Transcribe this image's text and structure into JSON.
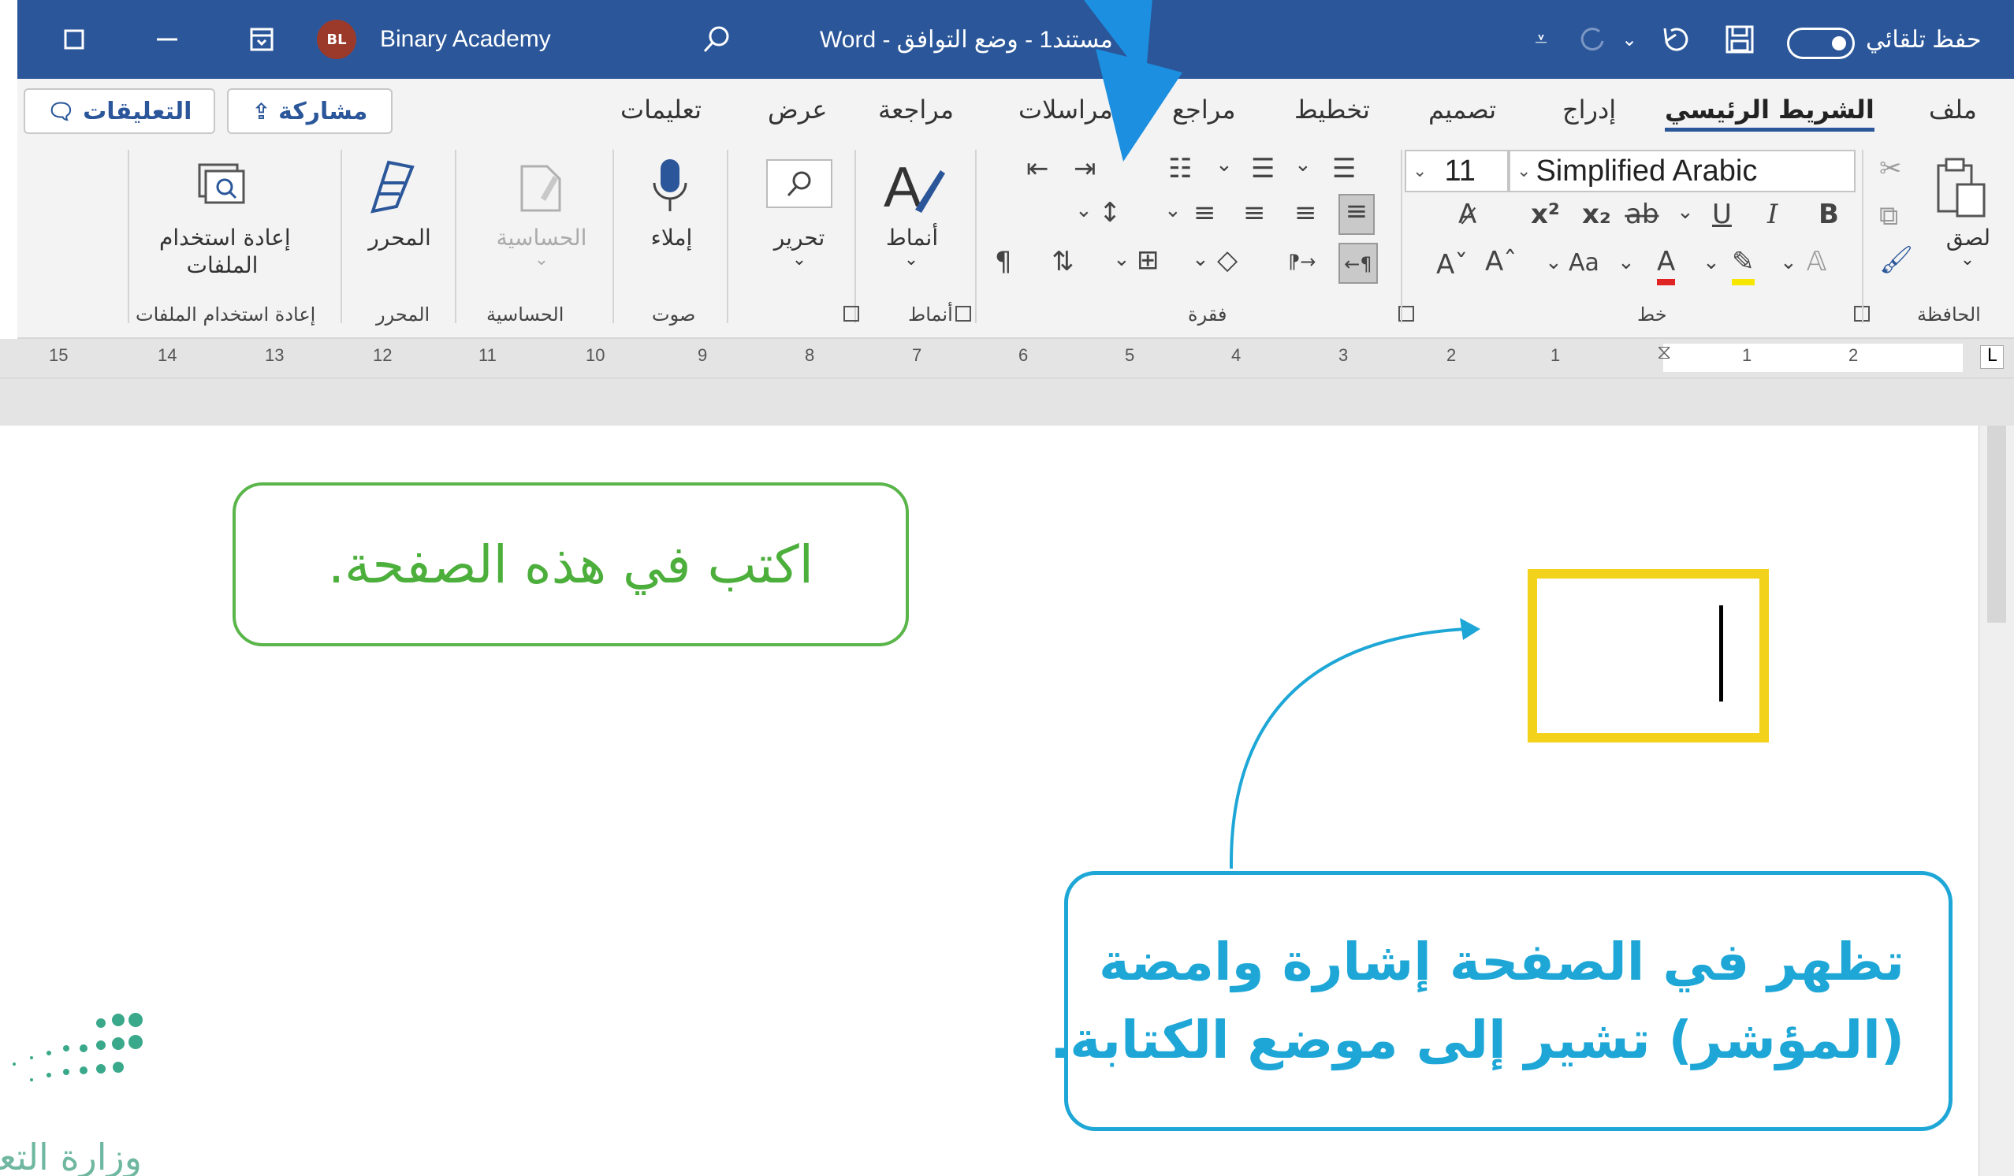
{
  "titlebar": {
    "account_name": "Binary Academy",
    "avatar_initials": "BL",
    "doc_title": "مستند1  -  وضع التوافق  -  Word",
    "autosave_label": "حفظ تلقائي"
  },
  "menu": {
    "tabs": [
      "ملف",
      "الشريط الرئيسي",
      "إدراج",
      "تصميم",
      "تخطيط",
      "مراجع",
      "مراسلات",
      "مراجعة",
      "عرض",
      "تعليمات"
    ],
    "active_tab": "الشريط الرئيسي",
    "share_label": "مشاركة",
    "comments_label": "التعليقات"
  },
  "ribbon": {
    "clipboard": {
      "paste_label": "لصق",
      "group_label": "الحافظة"
    },
    "font": {
      "font_name": "Simplified Arabic",
      "font_size": "11",
      "group_label": "خط",
      "bold": "B",
      "italic": "I",
      "underline": "U"
    },
    "paragraph": {
      "group_label": "فقرة"
    },
    "styles": {
      "styles_label": "أنماط",
      "group_label": "أنماط"
    },
    "editing": {
      "label": "تحرير"
    },
    "voice": {
      "dictate_label": "إملاء",
      "group_label": "صوت"
    },
    "sensitivity": {
      "label": "الحساسية",
      "group_label": "الحساسية"
    },
    "editor": {
      "label": "المحرر",
      "group_label": "المحرر"
    },
    "reuse": {
      "label_line1": "إعادة استخدام",
      "label_line2": "الملفات",
      "group_label": "إعادة استخدام الملفات"
    }
  },
  "ruler": {
    "numbers_right": [
      "1",
      "2"
    ],
    "numbers_left": [
      "1",
      "2",
      "3",
      "4",
      "5",
      "6",
      "7",
      "8",
      "9",
      "10",
      "11",
      "12",
      "13",
      "14",
      "15"
    ]
  },
  "page": {
    "callout_green": "اكتب في هذه الصفحة.",
    "callout_blue_line1": "تظهر في الصفحة إشارة وامضة",
    "callout_blue_line2": "(المؤشر) تشير إلى موضع الكتابة.",
    "logo_text": "وزارة التعليم"
  },
  "colors": {
    "titlebar": "#2b579a",
    "callout_green": "#5ab54a",
    "callout_blue": "#1ea7d6",
    "cursor_box": "#f2d21a"
  }
}
